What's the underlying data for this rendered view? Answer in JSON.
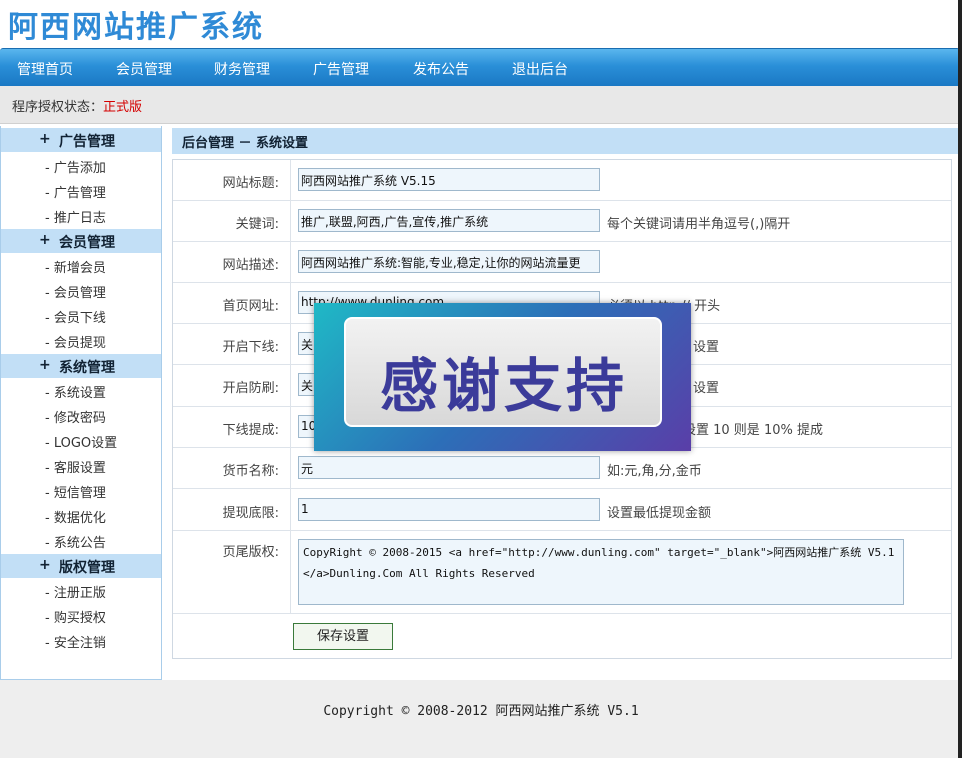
{
  "site": {
    "title": "阿西网站推广系统"
  },
  "nav": [
    "管理首页",
    "会员管理",
    "财务管理",
    "广告管理",
    "发布公告",
    "退出后台"
  ],
  "status": {
    "label": "程序授权状态：",
    "value": "正式版"
  },
  "sidebar": {
    "groups": [
      {
        "title": "广告管理",
        "items": [
          "广告添加",
          "广告管理",
          "推广日志"
        ]
      },
      {
        "title": "会员管理",
        "items": [
          "新增会员",
          "会员管理",
          "会员下线",
          "会员提现"
        ]
      },
      {
        "title": "系统管理",
        "items": [
          "系统设置",
          "修改密码",
          "LOGO设置",
          "客服设置",
          "短信管理",
          "数据优化",
          "系统公告"
        ]
      },
      {
        "title": "版权管理",
        "items": [
          "注册正版",
          "购买授权",
          "安全注销"
        ]
      }
    ]
  },
  "breadcrumb": "后台管理 － 系统设置",
  "form": {
    "site_title_label": "网站标题:",
    "site_title_value": "阿西网站推广系统 V5.15",
    "keywords_label": "关键词:",
    "keywords_value": "推广,联盟,阿西,广告,宣传,推广系统",
    "keywords_hint": "每个关键词请用半角逗号(,)隔开",
    "desc_label": "网站描述:",
    "desc_value": "阿西网站推广系统:智能,专业,稳定,让你的网站流量更",
    "url_label": "首页网址:",
    "url_value": "http://www.dunling.com",
    "url_hint": "必须以 http:// 开头",
    "downline_label": "开启下线:",
    "downline_value": "关",
    "downline_hint": "设置",
    "antiflood_label": "开启防刷:",
    "antiflood_value": "关",
    "antiflood_hint": "设置",
    "commission_label": "下线提成:",
    "commission_value": "10",
    "commission_hint": "设置 10 则是 10% 提成",
    "currency_label": "货币名称:",
    "currency_value": "元",
    "currency_hint": "如:元,角,分,金币",
    "min_withdraw_label": "提现底限:",
    "min_withdraw_value": "1",
    "min_withdraw_hint": "设置最低提现金额",
    "footer_label": "页尾版权:",
    "footer_value": "CopyRight © 2008-2015 <a href=\"http://www.dunling.com\" target=\"_blank\">阿西网站推广系统 V5.1 </a>Dunling.Com All Rights Reserved",
    "save_label": "保存设置"
  },
  "overlay": {
    "text": "感谢支持"
  },
  "page_footer": "Copyright © 2008-2012 阿西网站推广系统 V5.1"
}
